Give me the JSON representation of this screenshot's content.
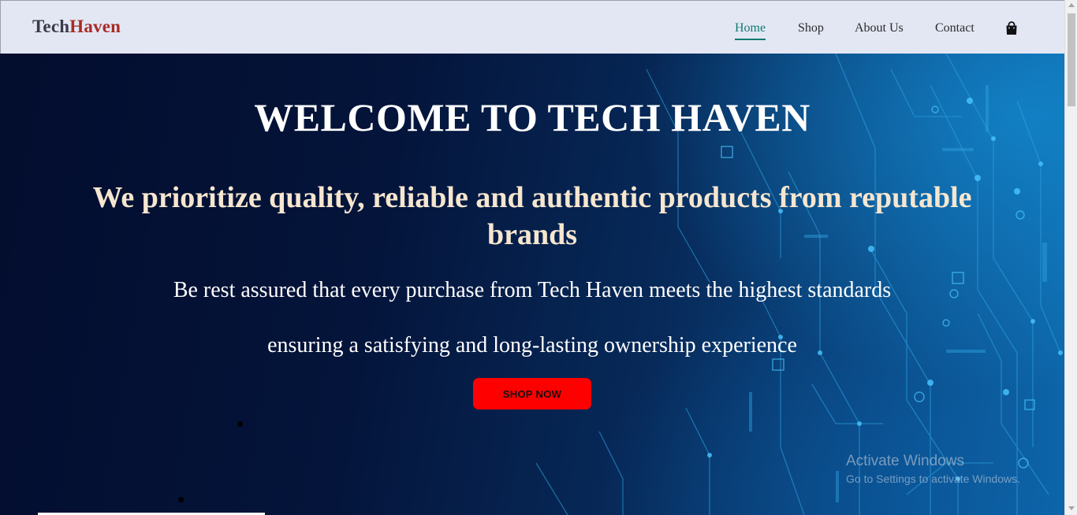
{
  "brand": {
    "part1": "Tech",
    "part2": "Haven"
  },
  "nav": {
    "items": [
      {
        "label": "Home",
        "active": true
      },
      {
        "label": "Shop",
        "active": false
      },
      {
        "label": "About Us",
        "active": false
      },
      {
        "label": "Contact",
        "active": false
      }
    ],
    "cart_icon": "shopping-bag-icon",
    "active_color": "#117a72"
  },
  "hero": {
    "title": "WELCOME TO TECH HAVEN",
    "subtitle": "We prioritize quality, reliable and authentic products from reputable brands",
    "line1": "Be rest assured that every purchase from Tech Haven meets the highest standards",
    "line2": "ensuring a satisfying and long-lasting ownership experience",
    "cta_label": "SHOP NOW",
    "cta_color": "#ff0000",
    "subtitle_color": "#f6e6cf"
  },
  "watermark": {
    "title": "Activate Windows",
    "subtitle": "Go to Settings to activate Windows."
  },
  "colors": {
    "navbar_bg": "#e3e7f4",
    "brand_dark": "#3b3b47",
    "brand_red": "#a82c24"
  }
}
